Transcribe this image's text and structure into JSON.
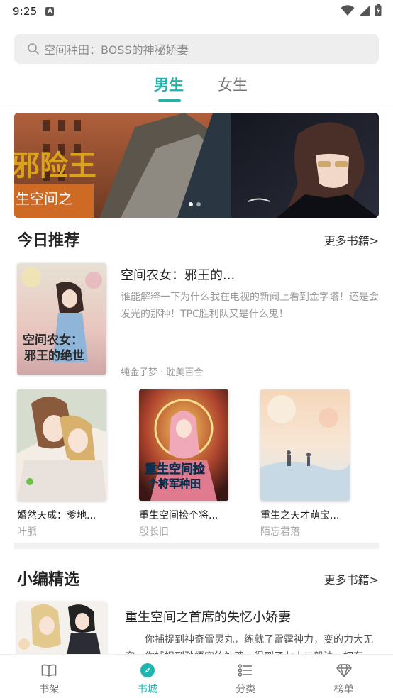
{
  "status_bar": {
    "time": "9:25",
    "notification": "A"
  },
  "search": {
    "placeholder": "空间种田：BOSS的神秘娇妻"
  },
  "tabs": [
    {
      "label": "男生",
      "active": true
    },
    {
      "label": "女生",
      "active": false
    }
  ],
  "banner": {
    "slide_text": "邪险王",
    "slide_text_2": "生空间之",
    "slide_count": 2,
    "active_slide": 0
  },
  "today": {
    "title": "今日推荐",
    "more": "更多书籍>",
    "featured": {
      "title": "空间农女：邪王的...",
      "desc": "谁能解释一下为什么我在电视的新闻上看到金字塔！还是会发光的那种！TPC胜利队又是什么鬼！",
      "meta": "纯金子梦 · 耽美百合",
      "cover_text": "空间农女：邪王的绝世"
    },
    "books": [
      {
        "title": "婚然天成：爹地...",
        "author": "叶脈"
      },
      {
        "title": "重生空间捡个将...",
        "author": "殷长旧",
        "cover_text": "重生空间捡个将军种田"
      },
      {
        "title": "重生之天才萌宝...",
        "author": "陌忘君落"
      }
    ]
  },
  "editor": {
    "title": "小编精选",
    "more": "更多书籍>",
    "pick": {
      "title": "重生空间之首席的失忆小娇妻",
      "desc": "你捕捉到神奇雷灵丸，练就了雷霆神力，变的力大无穷。你捕捉到孙悟空的神魂，得到了七十二般法，拥有"
    }
  },
  "bottom_nav": [
    {
      "label": "书架",
      "icon": "book-open-icon",
      "active": false
    },
    {
      "label": "书城",
      "icon": "compass-icon",
      "active": true
    },
    {
      "label": "分类",
      "icon": "list-icon",
      "active": false
    },
    {
      "label": "榜单",
      "icon": "diamond-icon",
      "active": false
    }
  ],
  "colors": {
    "accent": "#1fb5ae",
    "text": "#222222",
    "muted": "#999999"
  }
}
